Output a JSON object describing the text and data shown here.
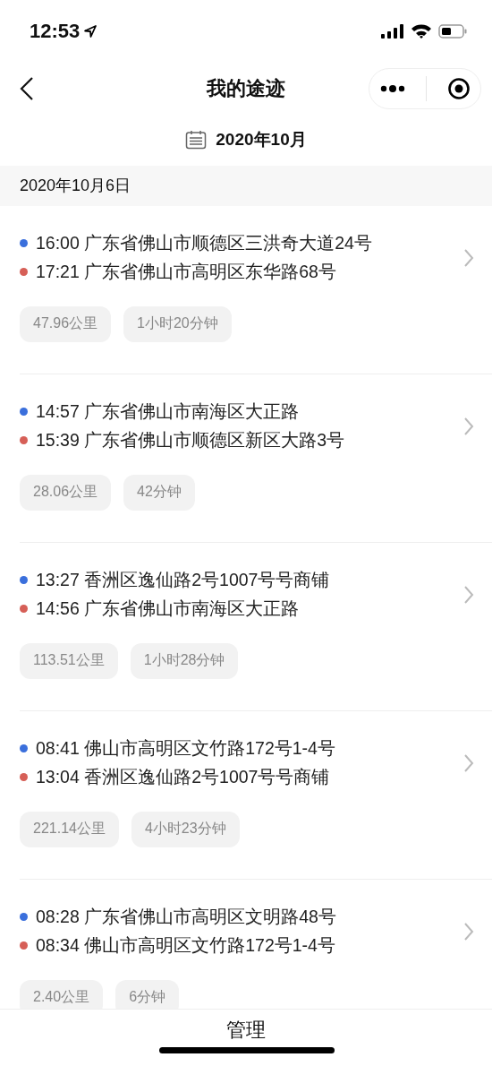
{
  "status_bar": {
    "time": "12:53"
  },
  "nav": {
    "title": "我的途迹"
  },
  "month": {
    "label": "2020年10月"
  },
  "date_header": "2020年10月6日",
  "trips": [
    {
      "points": [
        {
          "kind": "start",
          "time": "16:00",
          "place": "广东省佛山市顺德区三洪奇大道24号"
        },
        {
          "kind": "end",
          "time": "17:21",
          "place": "广东省佛山市高明区东华路68号"
        }
      ],
      "distance": "47.96公里",
      "duration": "1小时20分钟"
    },
    {
      "points": [
        {
          "kind": "start",
          "time": "14:57",
          "place": "广东省佛山市南海区大正路"
        },
        {
          "kind": "end",
          "time": "15:39",
          "place": "广东省佛山市顺德区新区大路3号"
        }
      ],
      "distance": "28.06公里",
      "duration": "42分钟"
    },
    {
      "points": [
        {
          "kind": "start",
          "time": "13:27",
          "place": "香洲区逸仙路2号1007号号商铺"
        },
        {
          "kind": "end",
          "time": "14:56",
          "place": "广东省佛山市南海区大正路"
        }
      ],
      "distance": "113.51公里",
      "duration": "1小时28分钟"
    },
    {
      "points": [
        {
          "kind": "start",
          "time": "08:41",
          "place": "佛山市高明区文竹路172号1-4号"
        },
        {
          "kind": "end",
          "time": "13:04",
          "place": "香洲区逸仙路2号1007号号商铺"
        }
      ],
      "distance": "221.14公里",
      "duration": "4小时23分钟"
    },
    {
      "points": [
        {
          "kind": "start",
          "time": "08:28",
          "place": "广东省佛山市高明区文明路48号"
        },
        {
          "kind": "end",
          "time": "08:34",
          "place": "佛山市高明区文竹路172号1-4号"
        }
      ],
      "distance": "2.40公里",
      "duration": "6分钟"
    }
  ],
  "bottom_bar": {
    "label": "管理"
  }
}
